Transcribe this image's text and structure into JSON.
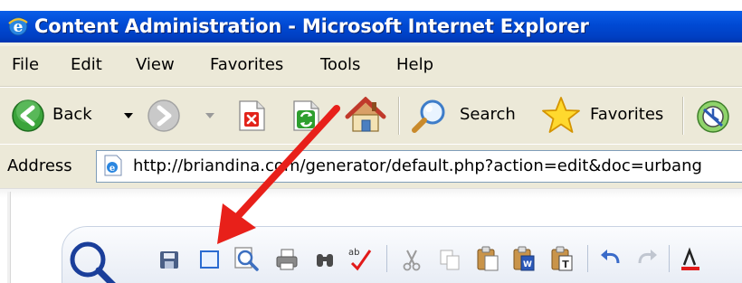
{
  "window": {
    "title": "Content Administration - Microsoft Internet Explorer"
  },
  "menu": {
    "items": [
      "File",
      "Edit",
      "View",
      "Favorites",
      "Tools",
      "Help"
    ]
  },
  "toolbar": {
    "back_label": "Back",
    "search_label": "Search",
    "favorites_label": "Favorites"
  },
  "address": {
    "label": "Address",
    "url": "http://briandina.com/generator/default.php?action=edit&doc=urbang"
  },
  "annotation": {
    "arrow_color": "#e8201a"
  },
  "icons": {
    "window": "ie-logo-icon",
    "back": "back-arrow-icon",
    "forward": "forward-arrow-icon",
    "stop": "stop-icon",
    "refresh": "refresh-icon",
    "home": "home-icon",
    "search": "magnifier-icon",
    "favorites": "star-icon",
    "media": "media-icon",
    "address_page": "page-icon",
    "editor": [
      "zoom-logo-icon",
      "save-icon",
      "preview-icon",
      "find-preview-icon",
      "print-icon",
      "binoculars-icon",
      "spellcheck-icon",
      "cut-icon",
      "copy-icon",
      "paste-icon",
      "paste-word-icon",
      "paste-text-icon",
      "undo-icon",
      "redo-icon",
      "text-color-icon"
    ]
  }
}
